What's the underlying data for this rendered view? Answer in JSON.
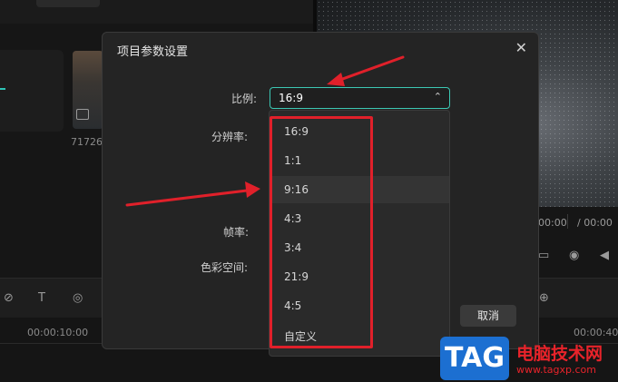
{
  "background_app": {
    "thumbnail_label": "71726",
    "time_current": "00:00",
    "time_separator": "/",
    "time_total": "00:00",
    "timeline_tc_1": "00:00:10:00",
    "timeline_tc_2": "00:00:40"
  },
  "dialog": {
    "title": "项目参数设置",
    "close_icon": "close-icon",
    "labels": {
      "ratio": "比例:",
      "resolution": "分辨率:",
      "frame_rate": "帧率:",
      "color_space": "色彩空间:"
    },
    "ratio_select": {
      "value": "16:9",
      "icon": "chevron-up-icon"
    },
    "ratio_options": [
      "16:9",
      "1:1",
      "9:16",
      "4:3",
      "3:4",
      "21:9",
      "4:5",
      "自定义"
    ],
    "hovered_option": "9:16",
    "cancel_label": "取消"
  },
  "watermark": {
    "logo_text": "TAG",
    "title": "电脑技术网",
    "url": "www.tagxp.com"
  },
  "colors": {
    "accent": "#3cc8b4",
    "annotation": "#e0202a",
    "dialog_bg": "#242424",
    "watermark_blue": "#1c6fd1"
  }
}
